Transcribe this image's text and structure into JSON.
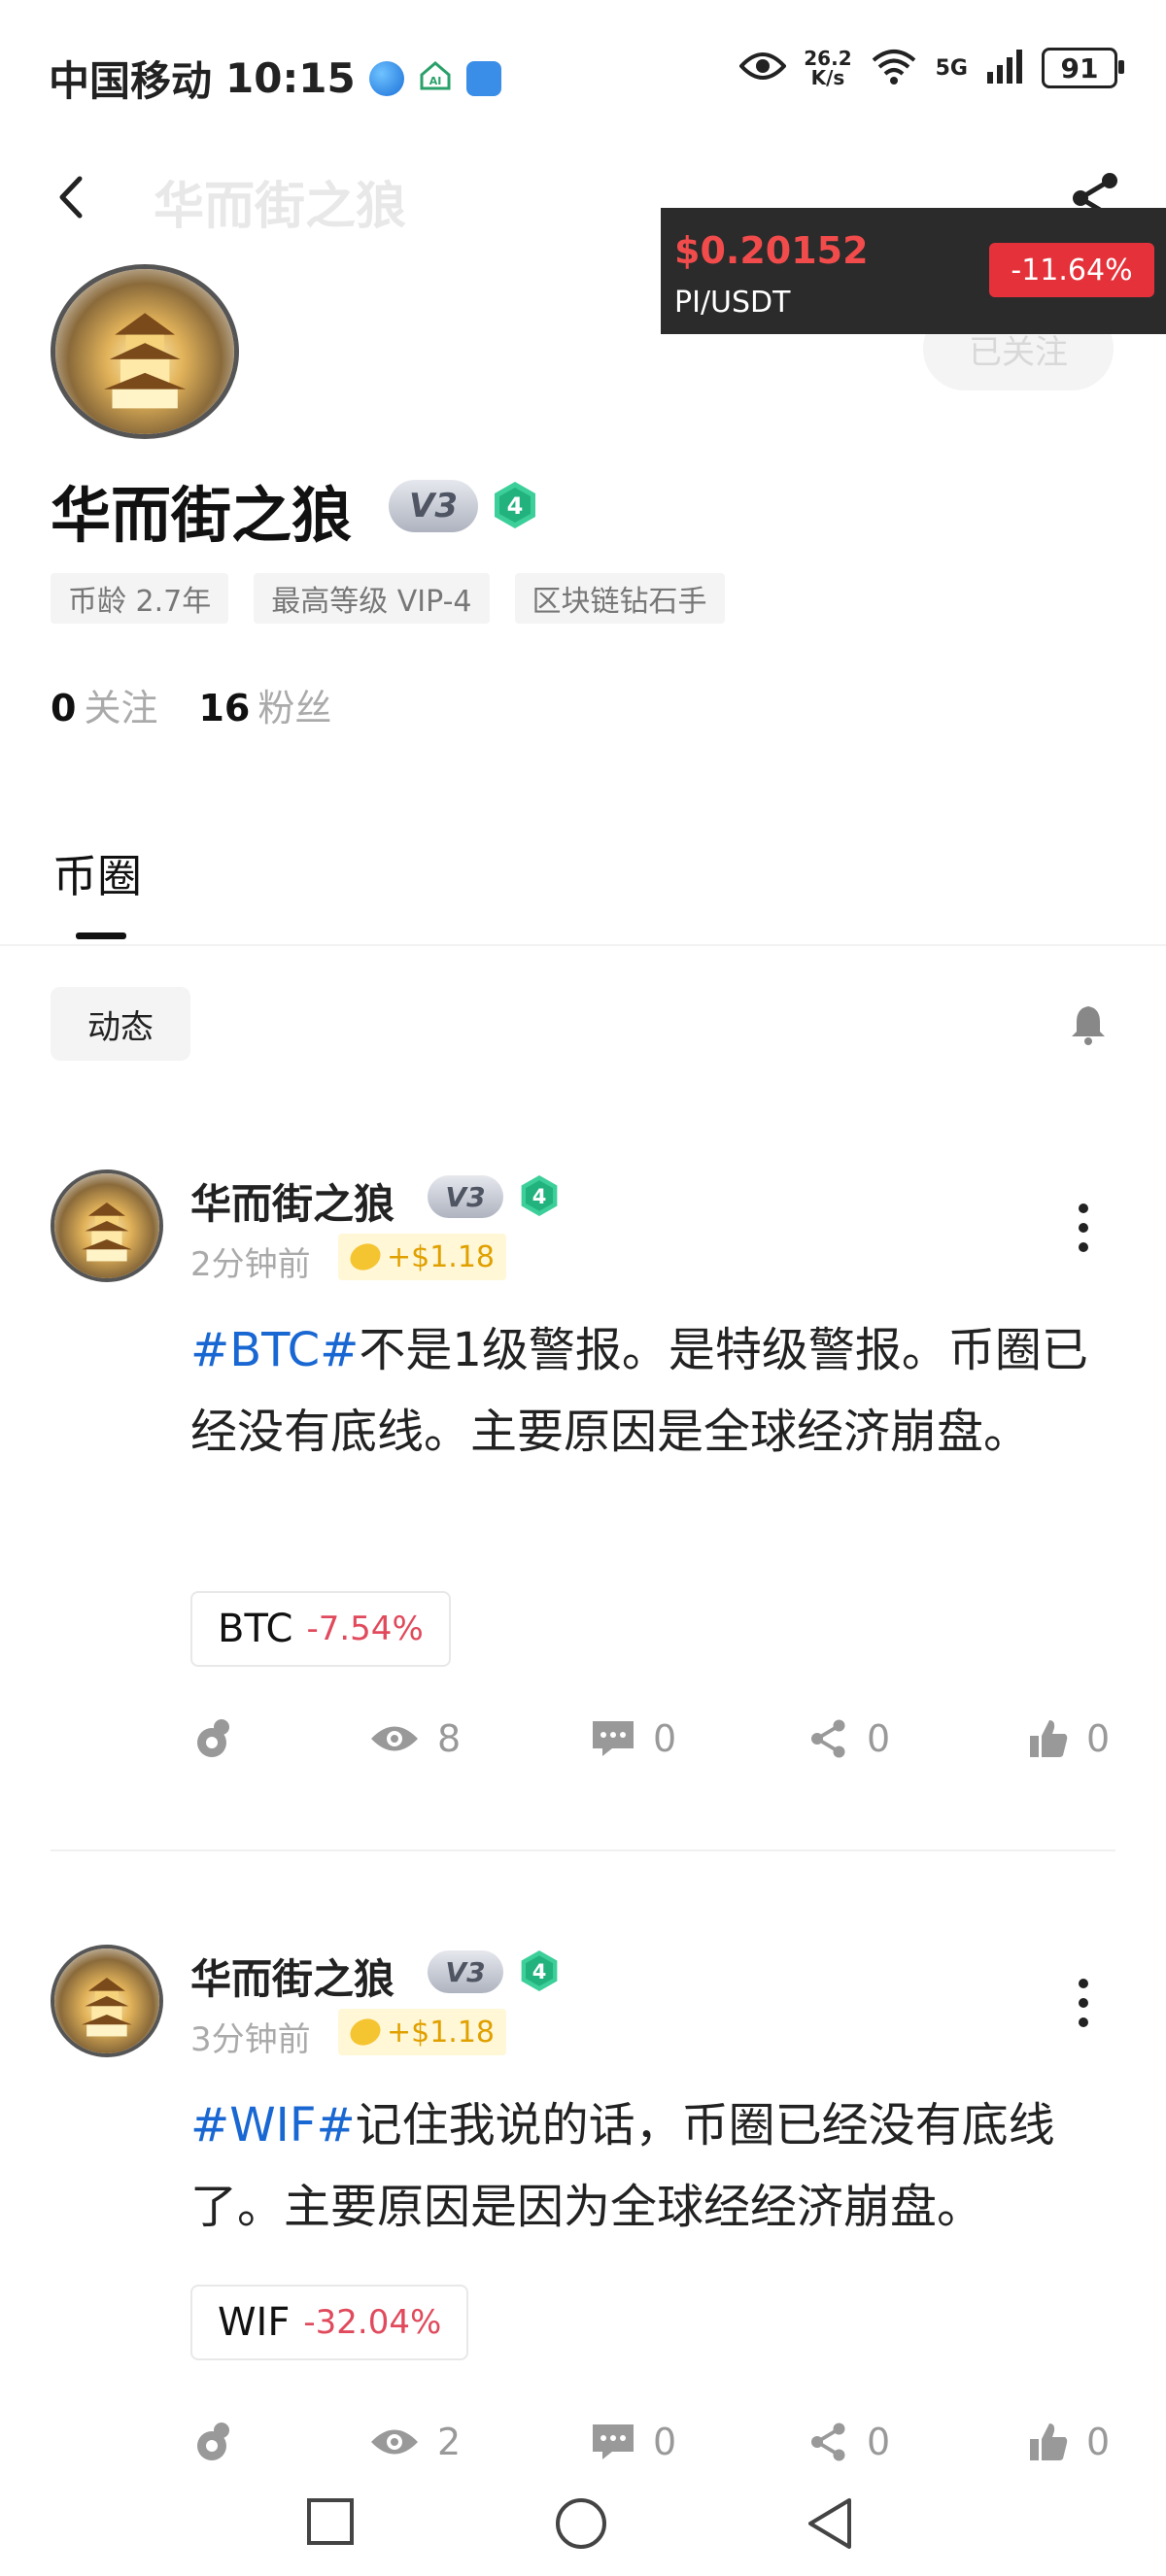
{
  "status_bar": {
    "carrier": "中国移动",
    "time": "10:15",
    "net_speed_top": "26.2",
    "net_speed_bottom": "K/s",
    "network_type": "5G",
    "battery": "91"
  },
  "header": {
    "title": "华而街之狼",
    "follow_label": "已关注"
  },
  "ticker": {
    "price": "$0.20152",
    "pair": "PI/USDT",
    "change": "-11.64%"
  },
  "profile": {
    "name": "华而街之狼",
    "vip_badge": "V3",
    "level": "4",
    "tags": [
      "币龄 2.7年",
      "最高等级 VIP-4",
      "区块链钻石手"
    ],
    "following_count": "0",
    "following_label": "关注",
    "followers_count": "16",
    "followers_label": "粉丝"
  },
  "tabs": {
    "coin": "币圈"
  },
  "filter": {
    "dynamic": "动态"
  },
  "posts": [
    {
      "author": "华而街之狼",
      "vip": "V3",
      "level": "4",
      "time": "2分钟前",
      "reward": "+$1.18",
      "hashtag": "#BTC#",
      "text": "不是1级警报。是特级警报。币圈已经没有底线。主要原因是全球经济崩盘。",
      "coin_symbol": "BTC",
      "coin_change": "-7.54%",
      "views": "8",
      "comments": "0",
      "shares": "0",
      "likes": "0"
    },
    {
      "author": "华而街之狼",
      "vip": "V3",
      "level": "4",
      "time": "3分钟前",
      "reward": "+$1.18",
      "hashtag": "#WIF#",
      "text": "记住我说的话，币圈已经没有底线了。主要原因是因为全球经经济崩盘。",
      "coin_symbol": "WIF",
      "coin_change": "-32.04%",
      "views": "2",
      "comments": "0",
      "shares": "0",
      "likes": "0"
    }
  ],
  "colors": {
    "hashtag": "#1967d2",
    "negative": "#e04a5c",
    "ticker_bg": "#2b2b2b",
    "ticker_badge": "#e5323a",
    "reward_bg": "#fff7d6"
  }
}
